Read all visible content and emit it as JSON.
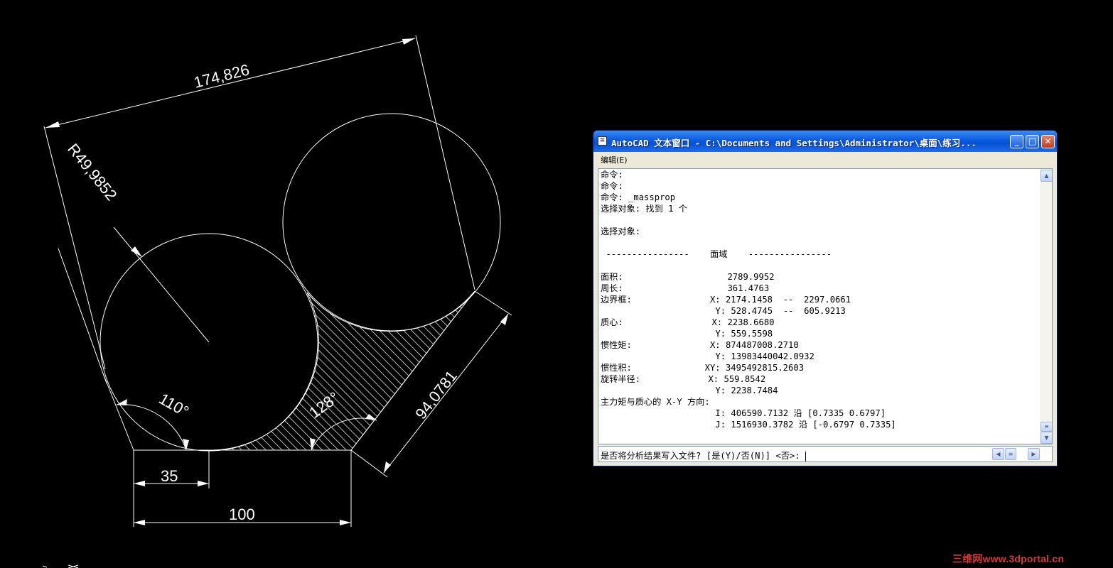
{
  "drawing": {
    "dims": {
      "top_length": "174,826",
      "radius": "R49,9852",
      "right_length": "94,0781",
      "angle_left": "110°",
      "angle_right": "128°",
      "bottom_short": "35",
      "bottom_long": "100"
    },
    "line_color": "#ffffff",
    "background": "#000000"
  },
  "text_window": {
    "title": "AutoCAD 文本窗口 - C:\\Documents and Settings\\Administrator\\桌面\\练习...",
    "menu_edit": "编辑(E)",
    "title_buttons": {
      "minimize": "_",
      "maximize": "□",
      "close": "✕"
    },
    "history": [
      "命令:",
      "命令:",
      "命令: _massprop",
      "选择对象: 找到 1 个",
      "",
      "选择对象:",
      "",
      " ----------------    面域    ----------------",
      "",
      "面积:                    2789.9952",
      "周长:                    361.4763",
      "边界框:               X: 2174.1458  --  2297.0661",
      "                      Y: 528.4745  --  605.9213",
      "质心:                 X: 2238.6680",
      "                      Y: 559.5598",
      "惯性矩:               X: 874487008.2710",
      "                      Y: 13983440042.0932",
      "惯性积:              XY: 3495492815.2603",
      "旋转半径:             X: 559.8542",
      "                      Y: 2238.7484",
      "主力矩与质心的 X-Y 方向:",
      "                      I: 406590.7132 沿 [0.7335 0.6797]",
      "                      J: 1516930.3782 沿 [-0.6797 0.7335]"
    ],
    "prompt": "是否将分析结果写入文件? [是(Y)/否(N)] <否>: ",
    "titlebar_color": "#0a5ae0"
  },
  "watermark": "三维网www.3dportal.cn"
}
